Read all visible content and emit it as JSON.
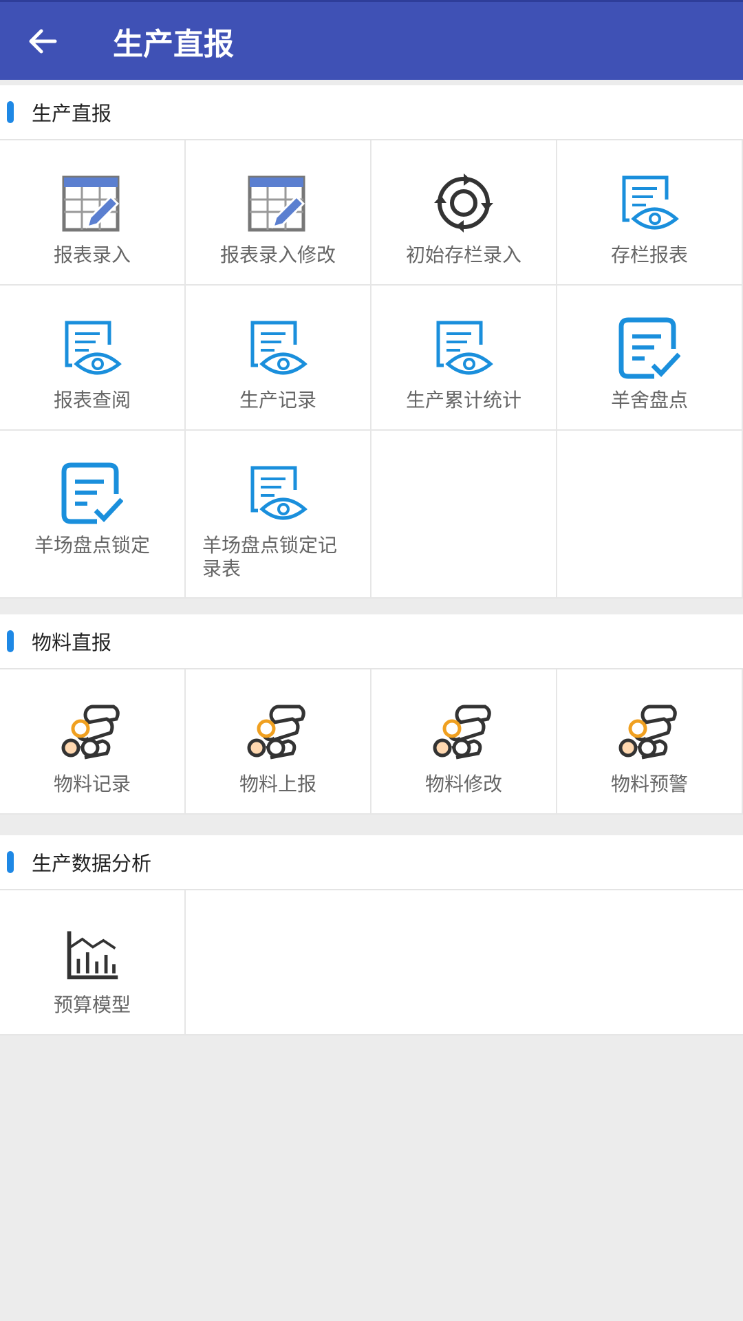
{
  "appbar": {
    "title": "生产直报"
  },
  "sections": [
    {
      "title": "生产直报",
      "items": [
        {
          "label": "报表录入",
          "icon": "table-edit-icon"
        },
        {
          "label": "报表录入修改",
          "icon": "table-edit-icon"
        },
        {
          "label": "初始存栏录入",
          "icon": "refresh-circle-icon"
        },
        {
          "label": "存栏报表",
          "icon": "document-eye-icon"
        },
        {
          "label": "报表查阅",
          "icon": "document-eye-icon"
        },
        {
          "label": "生产记录",
          "icon": "document-eye-icon"
        },
        {
          "label": "生产累计统计",
          "icon": "document-eye-icon"
        },
        {
          "label": "羊舍盘点",
          "icon": "checklist-icon"
        },
        {
          "label": "羊场盘点锁定",
          "icon": "checklist-icon"
        },
        {
          "label": "羊场盘点锁定记录表",
          "icon": "document-eye-icon"
        }
      ]
    },
    {
      "title": "物料直报",
      "items": [
        {
          "label": "物料记录",
          "icon": "logs-icon"
        },
        {
          "label": "物料上报",
          "icon": "logs-icon"
        },
        {
          "label": "物料修改",
          "icon": "logs-icon"
        },
        {
          "label": "物料预警",
          "icon": "logs-icon"
        }
      ]
    },
    {
      "title": "生产数据分析",
      "items": [
        {
          "label": "预算模型",
          "icon": "bar-chart-icon"
        }
      ]
    }
  ],
  "colors": {
    "appbar": "#3f51b5",
    "accent": "#1e88e5",
    "icon_blue": "#1a8fdc",
    "icon_orange": "#f0a020"
  }
}
